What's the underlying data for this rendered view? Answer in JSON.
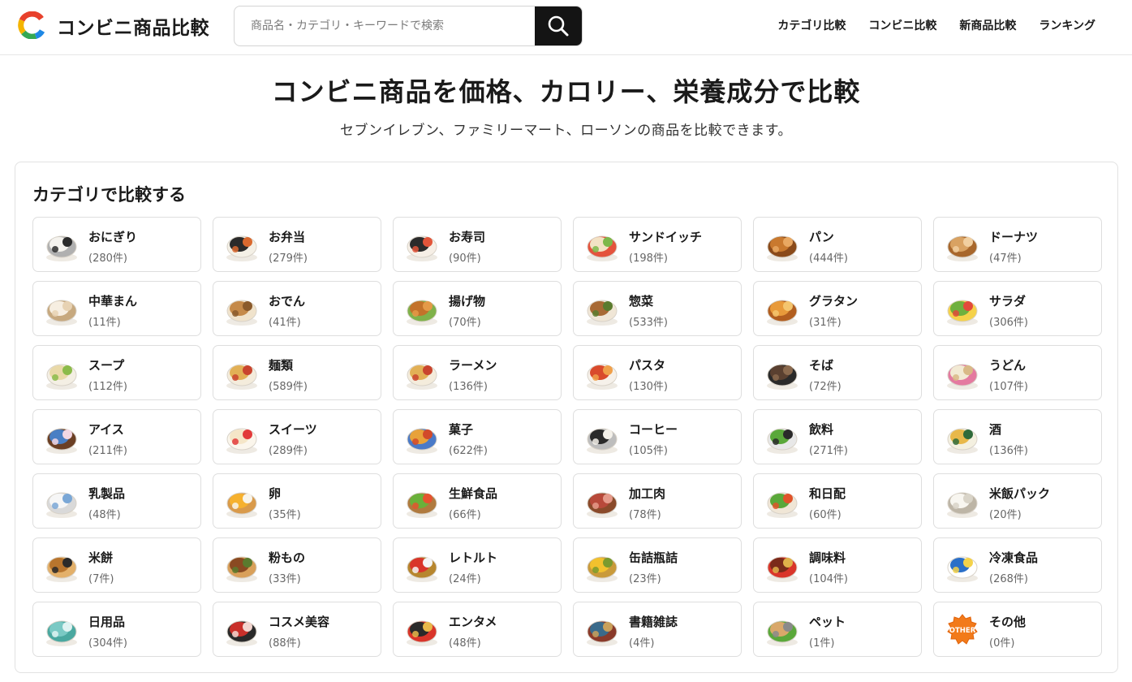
{
  "header": {
    "site_title": "コンビニ商品比較",
    "search_placeholder": "商品名・カテゴリ・キーワードで検索",
    "nav": [
      "カテゴリ比較",
      "コンビニ比較",
      "新商品比較",
      "ランキング"
    ]
  },
  "hero": {
    "title": "コンビニ商品を価格、カロリー、栄養成分で比較",
    "subtitle": "セブンイレブン、ファミリーマート、ローソンの商品を比較できます。"
  },
  "categories": {
    "title": "カテゴリで比較する",
    "items": [
      {
        "name": "おにぎり",
        "count": "(280件)",
        "icon": "onigiri-icon",
        "colors": [
          "#f5f3ee",
          "#2b2b2b",
          "#b0b0b0"
        ]
      },
      {
        "name": "お弁当",
        "count": "(279件)",
        "icon": "bento-icon",
        "colors": [
          "#2a2a2a",
          "#d9692f",
          "#f4f0e6"
        ]
      },
      {
        "name": "お寿司",
        "count": "(90件)",
        "icon": "sushi-icon",
        "colors": [
          "#2b2b2b",
          "#e2553a",
          "#f6efe6"
        ]
      },
      {
        "name": "サンドイッチ",
        "count": "(198件)",
        "icon": "sandwich-icon",
        "colors": [
          "#f3e2c4",
          "#7db84a",
          "#e4533d"
        ]
      },
      {
        "name": "パン",
        "count": "(444件)",
        "icon": "bread-icon",
        "colors": [
          "#c9792e",
          "#e9a862",
          "#8a4a1a"
        ]
      },
      {
        "name": "ドーナツ",
        "count": "(47件)",
        "icon": "donut-icon",
        "colors": [
          "#d9a262",
          "#f1cfa0",
          "#a8672c"
        ]
      },
      {
        "name": "中華まん",
        "count": "(11件)",
        "icon": "nikuman-icon",
        "colors": [
          "#f6eee1",
          "#e7d2b3",
          "#c7a97f"
        ]
      },
      {
        "name": "おでん",
        "count": "(41件)",
        "icon": "oden-icon",
        "colors": [
          "#c58a4a",
          "#8a5a2b",
          "#f0e3cc"
        ]
      },
      {
        "name": "揚げ物",
        "count": "(70件)",
        "icon": "fried-food-icon",
        "colors": [
          "#c3722a",
          "#e49a48",
          "#7fb24a"
        ]
      },
      {
        "name": "惣菜",
        "count": "(533件)",
        "icon": "side-dish-icon",
        "colors": [
          "#a86a34",
          "#5a7b2e",
          "#f0e6d6"
        ]
      },
      {
        "name": "グラタン",
        "count": "(31件)",
        "icon": "gratin-icon",
        "colors": [
          "#e89a3a",
          "#f4c56e",
          "#b25e1f"
        ]
      },
      {
        "name": "サラダ",
        "count": "(306件)",
        "icon": "salad-icon",
        "colors": [
          "#6fb03e",
          "#e24a3a",
          "#f5d24a"
        ]
      },
      {
        "name": "スープ",
        "count": "(112件)",
        "icon": "soup-icon",
        "colors": [
          "#e9d9a8",
          "#8bbb4a",
          "#f4efe4"
        ]
      },
      {
        "name": "麺類",
        "count": "(589件)",
        "icon": "noodles-icon",
        "colors": [
          "#e2b056",
          "#c9442e",
          "#f4ecdc"
        ]
      },
      {
        "name": "ラーメン",
        "count": "(136件)",
        "icon": "ramen-icon",
        "colors": [
          "#e2b056",
          "#c9442e",
          "#f4ecdc"
        ]
      },
      {
        "name": "パスタ",
        "count": "(130件)",
        "icon": "pasta-icon",
        "colors": [
          "#d94a2c",
          "#f0a04a",
          "#f6f1ea"
        ]
      },
      {
        "name": "そば",
        "count": "(72件)",
        "icon": "soba-icon",
        "colors": [
          "#5a4030",
          "#8b6a4e",
          "#2a2a2a"
        ]
      },
      {
        "name": "うどん",
        "count": "(107件)",
        "icon": "udon-icon",
        "colors": [
          "#f2ead4",
          "#d9b986",
          "#e47aa0"
        ]
      },
      {
        "name": "アイス",
        "count": "(211件)",
        "icon": "ice-cream-icon",
        "colors": [
          "#4a7fc4",
          "#f3d7e4",
          "#6b3f24"
        ]
      },
      {
        "name": "スイーツ",
        "count": "(289件)",
        "icon": "cake-icon",
        "colors": [
          "#f5e6c8",
          "#e23a3a",
          "#fbf6ec"
        ]
      },
      {
        "name": "菓子",
        "count": "(622件)",
        "icon": "snacks-icon",
        "colors": [
          "#e8a23a",
          "#d24a2a",
          "#4a7ac8"
        ]
      },
      {
        "name": "コーヒー",
        "count": "(105件)",
        "icon": "coffee-icon",
        "colors": [
          "#2a2a2a",
          "#f4f1ea",
          "#bdbdbd"
        ]
      },
      {
        "name": "飲料",
        "count": "(271件)",
        "icon": "drinks-icon",
        "colors": [
          "#5aa83a",
          "#2a2a2a",
          "#e8e8e8"
        ]
      },
      {
        "name": "酒",
        "count": "(136件)",
        "icon": "alcohol-icon",
        "colors": [
          "#e8b84a",
          "#2f6a3a",
          "#f4f0e0"
        ]
      },
      {
        "name": "乳製品",
        "count": "(48件)",
        "icon": "dairy-icon",
        "colors": [
          "#f6f6f6",
          "#7aa7d6",
          "#d9d9d9"
        ]
      },
      {
        "name": "卵",
        "count": "(35件)",
        "icon": "egg-icon",
        "colors": [
          "#f6b12e",
          "#f8f4ea",
          "#d99a4a"
        ]
      },
      {
        "name": "生鮮食品",
        "count": "(66件)",
        "icon": "fresh-produce-icon",
        "colors": [
          "#6ab13a",
          "#e5532f",
          "#b07a3e"
        ]
      },
      {
        "name": "加工肉",
        "count": "(78件)",
        "icon": "processed-meat-icon",
        "colors": [
          "#b8493a",
          "#e59a8a",
          "#8a4a2a"
        ]
      },
      {
        "name": "和日配",
        "count": "(60件)",
        "icon": "japanese-chilled-icon",
        "colors": [
          "#5aa83a",
          "#e0532a",
          "#f0e6d6"
        ]
      },
      {
        "name": "米飯パック",
        "count": "(20件)",
        "icon": "rice-pack-icon",
        "colors": [
          "#f8f6f0",
          "#d9d4c8",
          "#bdb5a6"
        ]
      },
      {
        "name": "米餅",
        "count": "(7件)",
        "icon": "rice-cracker-icon",
        "colors": [
          "#b8752e",
          "#2a2a2a",
          "#e3b06a"
        ]
      },
      {
        "name": "粉もの",
        "count": "(33件)",
        "icon": "okonomiyaki-icon",
        "colors": [
          "#8a4a22",
          "#5a7b2e",
          "#d9a05a"
        ]
      },
      {
        "name": "レトルト",
        "count": "(24件)",
        "icon": "retort-food-icon",
        "colors": [
          "#d9352a",
          "#f4f4f4",
          "#b7862e"
        ]
      },
      {
        "name": "缶詰瓶詰",
        "count": "(23件)",
        "icon": "canned-food-icon",
        "colors": [
          "#f2c12e",
          "#7a9a2e",
          "#c99a3a"
        ]
      },
      {
        "name": "調味料",
        "count": "(104件)",
        "icon": "seasoning-icon",
        "colors": [
          "#7a2a1a",
          "#e0b04a",
          "#d9352a"
        ]
      },
      {
        "name": "冷凍食品",
        "count": "(268件)",
        "icon": "frozen-food-icon",
        "colors": [
          "#2a6fc8",
          "#f4d24a",
          "#ffffff"
        ]
      },
      {
        "name": "日用品",
        "count": "(304件)",
        "icon": "daily-goods-icon",
        "colors": [
          "#7ac9c4",
          "#dff3f2",
          "#4aa8a0"
        ]
      },
      {
        "name": "コスメ美容",
        "count": "(88件)",
        "icon": "cosmetics-icon",
        "colors": [
          "#c9302a",
          "#f3d6cf",
          "#2a2a2a"
        ]
      },
      {
        "name": "エンタメ",
        "count": "(48件)",
        "icon": "entertainment-icon",
        "colors": [
          "#2a2a2a",
          "#e8b84a",
          "#d9352a"
        ]
      },
      {
        "name": "書籍雑誌",
        "count": "(4件)",
        "icon": "books-icon",
        "colors": [
          "#3a6a8a",
          "#c9a05a",
          "#8a3a2a"
        ]
      },
      {
        "name": "ペット",
        "count": "(1件)",
        "icon": "pet-icon",
        "colors": [
          "#d9a86a",
          "#8a8a8a",
          "#5aa83a"
        ]
      },
      {
        "name": "その他",
        "count": "(0件)",
        "icon": "other-icon",
        "label": "OTHER",
        "colors": [
          "#f27a1a",
          "#ffffff",
          "#e0620a"
        ]
      }
    ]
  },
  "colors": {
    "search_button": "#141414",
    "logo": [
      "#e8412c",
      "#f4b400",
      "#1e88e5",
      "#34a853"
    ]
  }
}
